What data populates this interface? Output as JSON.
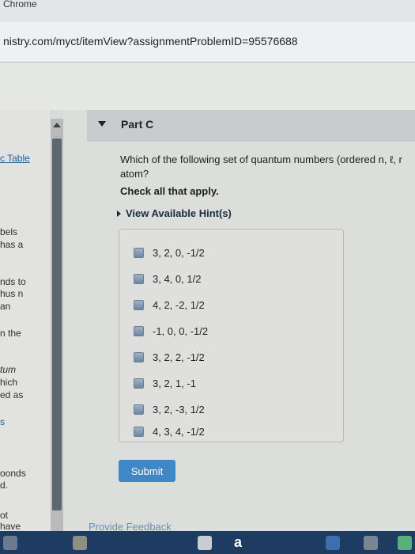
{
  "window": {
    "title": "Chrome"
  },
  "browser": {
    "url": "nistry.com/myct/itemView?assignmentProblemID=95576688"
  },
  "left_panel": {
    "lines": [
      "c Table",
      "bels",
      "has a",
      "nds to",
      "hus n",
      " an",
      "n the",
      "tum",
      "hich",
      "ed as",
      "s",
      "oonds",
      "d.",
      "ot",
      "have"
    ]
  },
  "part": {
    "label": "Part C"
  },
  "question": {
    "text_line1": "Which of the following set of quantum numbers (ordered n, ℓ, r",
    "text_line2": "atom?",
    "instruction": "Check all that apply.",
    "hints_label": "View Available Hint(s)"
  },
  "options": [
    {
      "label": "3, 2, 0, -1/2"
    },
    {
      "label": "3, 4, 0, 1/2"
    },
    {
      "label": "4, 2, -2, 1/2"
    },
    {
      "label": "-1, 0, 0, -1/2"
    },
    {
      "label": "3, 2, 2, -1/2"
    },
    {
      "label": "3, 2, 1, -1"
    },
    {
      "label": "3, 2, -3, 1/2"
    },
    {
      "label": "4, 3, 4, -1/2"
    }
  ],
  "actions": {
    "submit_label": "Submit",
    "feedback_label": "Provide Feedback"
  },
  "taskbar": {
    "letter": "a"
  },
  "colors": {
    "accent": "#3f87c6",
    "link": "#1f5d96"
  }
}
